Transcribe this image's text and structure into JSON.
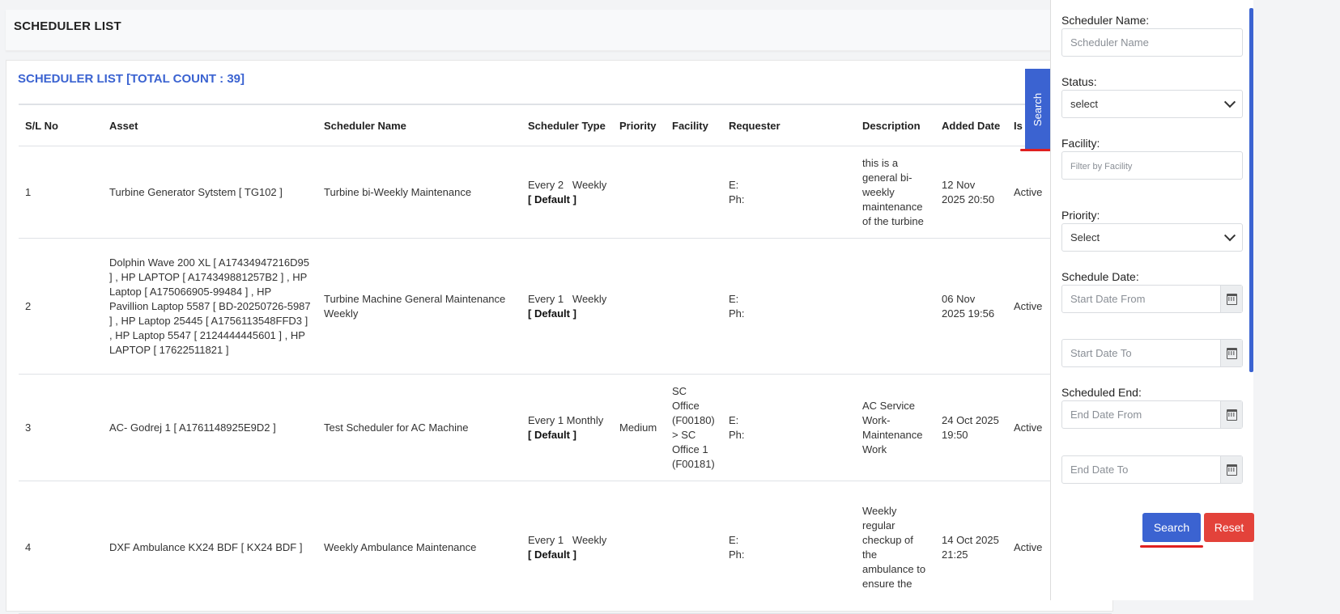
{
  "page_title": "SCHEDULER LIST",
  "list_title": "SCHEDULER LIST [TOTAL COUNT : 39]",
  "table": {
    "headers": [
      "S/L No",
      "Asset",
      "Scheduler Name",
      "Scheduler Type",
      "Priority",
      "Facility",
      "Requester",
      "Description",
      "Added Date",
      "Is"
    ],
    "rows": [
      {
        "sl": "1",
        "asset": "Turbine Generator Sytstem [ TG102 ]",
        "name": "Turbine bi-Weekly Maintenance",
        "type": "Every 2   Weekly",
        "type_tag": "[ Default ]",
        "priority": "",
        "facility": "",
        "req_email": "E:",
        "req_phone": "Ph:",
        "description": "this is a general bi-weekly maintenance of the turbine",
        "added": "12 Nov 2025 20:50",
        "status": "Active"
      },
      {
        "sl": "2",
        "asset": "Dolphin Wave 200 XL [ A17434947216D95 ] , HP LAPTOP [ A174349881257B2 ] , HP Laptop [ A175066905-99484 ] , HP Pavillion Laptop 5587 [ BD-20250726-5987 ] , HP Laptop 25445 [ A1756113548FFD3 ] , HP Laptop 5547 [ 2124444445601 ] , HP LAPTOP [ 17622511821 ]",
        "name": "Turbine Machine General Maintenance Weekly",
        "type": "Every 1   Weekly",
        "type_tag": "[ Default ]",
        "priority": "",
        "facility": "",
        "req_email": "E:",
        "req_phone": "Ph:",
        "description": "",
        "added": "06 Nov 2025 19:56",
        "status": "Active"
      },
      {
        "sl": "3",
        "asset": "AC- Godrej 1 [ A1761148925E9D2 ]",
        "name": "Test Scheduler for AC Machine",
        "type": "Every 1 Monthly",
        "type_tag": "[ Default ]",
        "priority": "Medium",
        "facility": "SC Office (F00180) > SC Office 1 (F00181)",
        "req_email": "E:",
        "req_phone": "Ph:",
        "description": "AC Service Work-Maintenance Work",
        "added": "24 Oct 2025 19:50",
        "status": "Active"
      },
      {
        "sl": "4",
        "asset": "DXF Ambulance KX24 BDF [ KX24 BDF ]",
        "name": "Weekly Ambulance Maintenance",
        "type": "Every 1   Weekly",
        "type_tag": "[ Default ]",
        "priority": "",
        "facility": "",
        "req_email": "E:",
        "req_phone": "Ph:",
        "description": "Weekly regular checkup of the ambulance to ensure the",
        "added": "14 Oct 2025 21:25",
        "status": "Active"
      }
    ]
  },
  "search_tab_label": "Search",
  "filters": {
    "scheduler_name_label": "Scheduler Name:",
    "scheduler_name_placeholder": "Scheduler Name",
    "status_label": "Status:",
    "status_value": "select",
    "facility_label": "Facility:",
    "facility_placeholder": "Filter by Facility",
    "priority_label": "Priority:",
    "priority_value": "Select",
    "schedule_date_label": "Schedule Date:",
    "start_from_placeholder": "Start Date From",
    "start_to_placeholder": "Start Date To",
    "scheduled_end_label": "Scheduled End:",
    "end_from_placeholder": "End Date From",
    "end_to_placeholder": "End Date To",
    "search_button": "Search",
    "reset_button": "Reset"
  },
  "colors": {
    "accent": "#3b63d1",
    "danger": "#e3423a",
    "highlight": "#e02020"
  },
  "icons": [
    "calendar-icon",
    "chevron-down-icon"
  ]
}
